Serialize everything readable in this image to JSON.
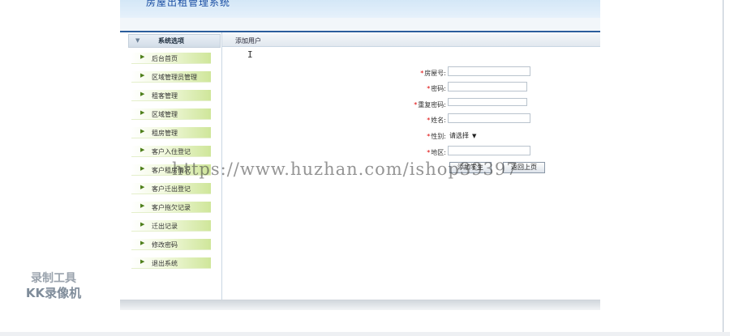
{
  "header": {
    "title": "房屋出租管理系统"
  },
  "sidebar": {
    "heading": "系统选项",
    "items": [
      {
        "label": "后台首页"
      },
      {
        "label": "区域管理员管理"
      },
      {
        "label": "租客管理"
      },
      {
        "label": "区域管理"
      },
      {
        "label": "租房管理"
      },
      {
        "label": "客户入住登记"
      },
      {
        "label": "客户租房情况"
      },
      {
        "label": "客户迁出登记"
      },
      {
        "label": "客户拖欠记录"
      },
      {
        "label": "迁出记录"
      },
      {
        "label": "修改密码"
      },
      {
        "label": "退出系统"
      }
    ]
  },
  "content": {
    "tab_title": "添加用户",
    "required_mark": "*",
    "fields": {
      "room_no": {
        "label": "房屋号:",
        "value": ""
      },
      "password": {
        "label": "密码:",
        "value": ""
      },
      "confirm_password": {
        "label": "重复密码:",
        "value": ""
      },
      "name": {
        "label": "姓名:",
        "value": ""
      },
      "gender": {
        "label": "性别:",
        "selected": "请选择"
      },
      "area": {
        "label": "地区:",
        "value": ""
      }
    },
    "buttons": {
      "submit": "添加学生",
      "back": "返回上页"
    }
  },
  "overlay": {
    "watermark": "https://www.huzhan.com/ishop39397",
    "recorder_line1": "录制工具",
    "recorder_line2": "KK录像机"
  },
  "colors": {
    "title_blue": "#1a4ea3",
    "topline": "#2b5d9c",
    "menu_green": "#cfe69a",
    "required": "#dd0000"
  }
}
